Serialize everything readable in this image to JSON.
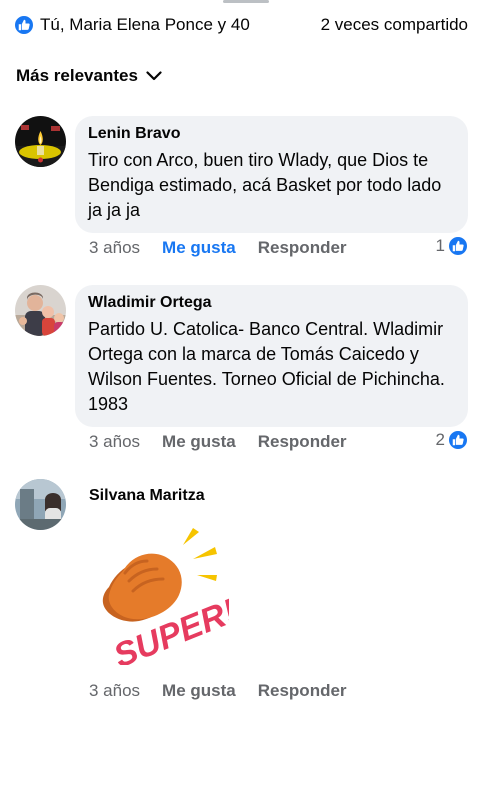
{
  "reactions": {
    "summary": "Tú, Maria Elena Ponce y 40",
    "shares": "2 veces compartido",
    "icon": "like-icon"
  },
  "sort": {
    "label": "Más relevantes",
    "icon": "chevron-down-icon"
  },
  "comments": [
    {
      "author": "Lenin Bravo",
      "text": "Tiro con Arco, buen tiro Wlady,  que Dios te Bendiga estimado, acá Basket por todo lado ja ja ja",
      "time": "3 años",
      "like": "Me gusta",
      "reply": "Responder",
      "likes": "1",
      "liked": true
    },
    {
      "author": "Wladimir Ortega",
      "text": "Partido U. Catolica- Banco Central. Wladimir Ortega con la marca de Tomás Caicedo y Wilson Fuentes. Torneo Oficial de Pichincha. 1983",
      "time": "3 años",
      "like": "Me gusta",
      "reply": "Responder",
      "likes": "2",
      "liked": false
    },
    {
      "author": "Silvana Maritza",
      "sticker_text": "SUPER!",
      "time": "3 años",
      "like": "Me gusta",
      "reply": "Responder"
    }
  ],
  "colors": {
    "accent": "#1877f2",
    "bubble": "#f0f2f5",
    "muted": "#65676b"
  }
}
